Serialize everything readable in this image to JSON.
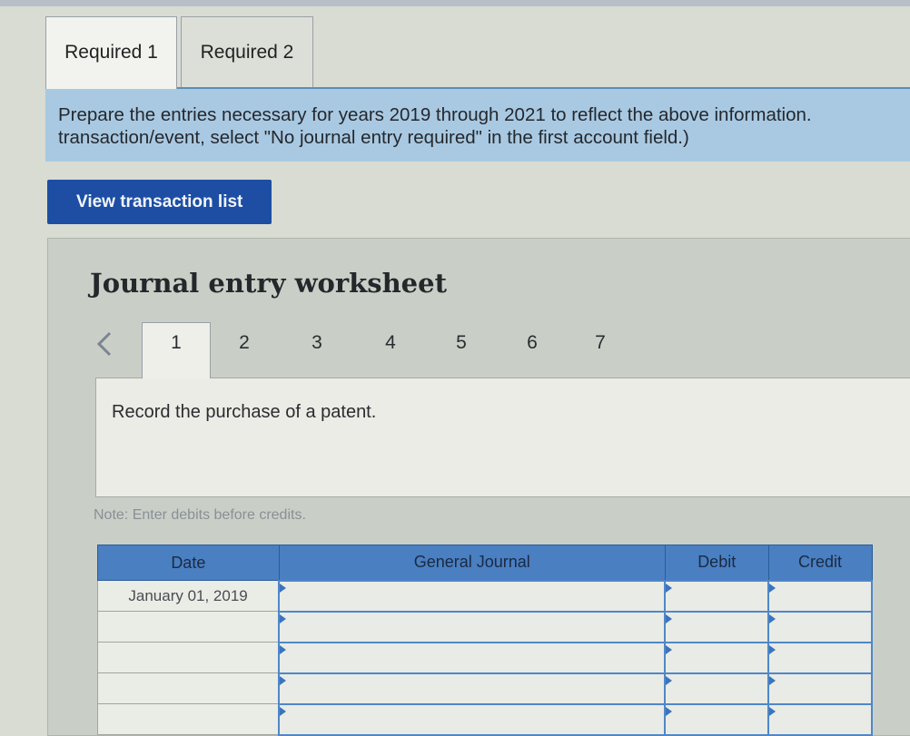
{
  "tabs": [
    {
      "label": "Required 1",
      "active": true
    },
    {
      "label": "Required 2",
      "active": false
    }
  ],
  "instructions": {
    "line1": "Prepare the entries necessary for years 2019 through 2021 to reflect the above information.",
    "line2": "transaction/event, select \"No journal entry required\" in the first account field.)"
  },
  "view_button": {
    "label": "View transaction list"
  },
  "worksheet": {
    "title": "Journal entry worksheet",
    "steps": [
      "1",
      "2",
      "3",
      "4",
      "5",
      "6",
      "7"
    ],
    "active_step": "1",
    "description": "Record the purchase of a patent.",
    "note": "Note: Enter debits before credits."
  },
  "journal_table": {
    "headers": {
      "date": "Date",
      "account": "General Journal",
      "debit": "Debit",
      "credit": "Credit"
    },
    "rows": [
      {
        "date": "January 01, 2019",
        "account": "",
        "debit": "",
        "credit": ""
      },
      {
        "date": "",
        "account": "",
        "debit": "",
        "credit": ""
      },
      {
        "date": "",
        "account": "",
        "debit": "",
        "credit": ""
      },
      {
        "date": "",
        "account": "",
        "debit": "",
        "credit": ""
      },
      {
        "date": "",
        "account": "",
        "debit": "",
        "credit": ""
      }
    ]
  },
  "colors": {
    "accent_blue": "#1d4ea3",
    "info_bg": "#a9c9e2",
    "table_header": "#4a7fc1"
  }
}
